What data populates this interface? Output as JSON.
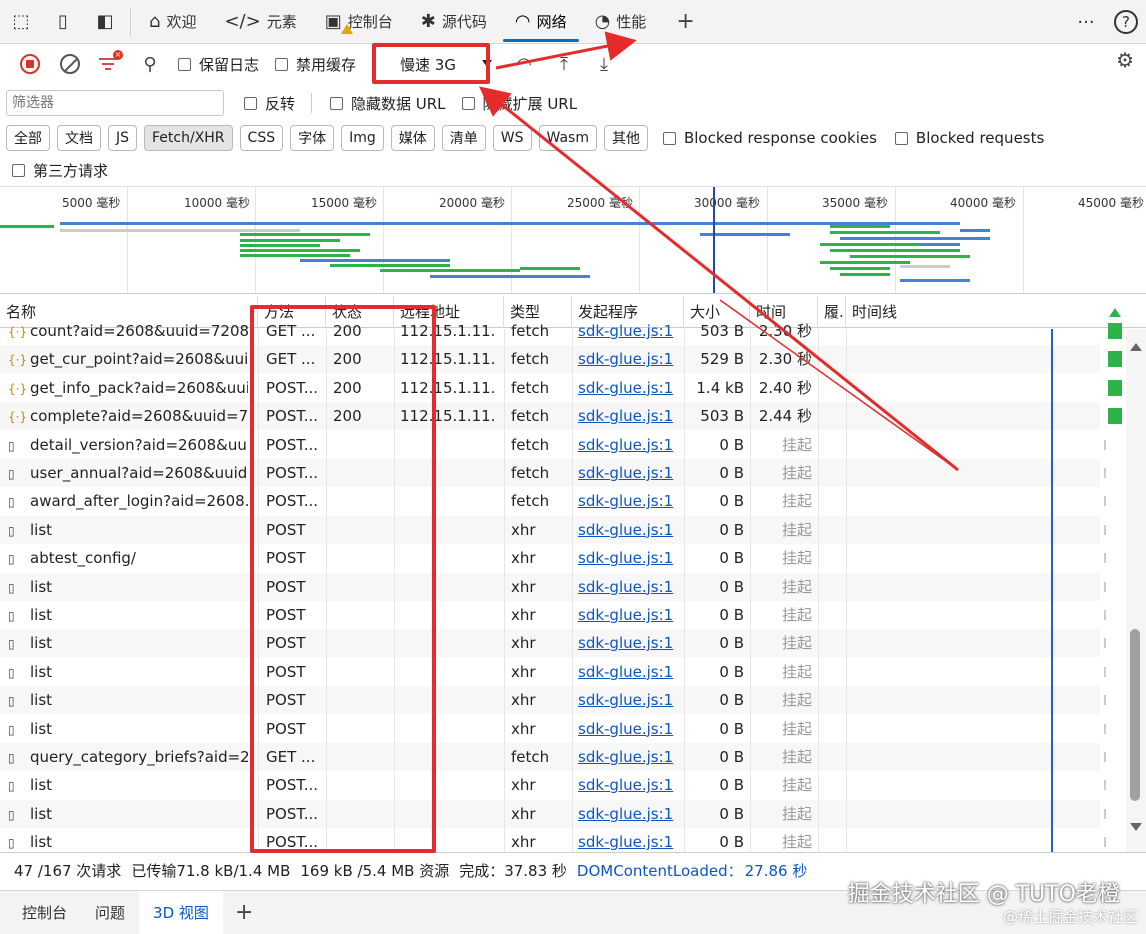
{
  "tabbar": {
    "tabs": [
      {
        "label": "欢迎",
        "icon": "home-icon"
      },
      {
        "label": "元素",
        "icon": "code-icon"
      },
      {
        "label": "控制台",
        "icon": "console-icon"
      },
      {
        "label": "源代码",
        "icon": "bug-icon"
      },
      {
        "label": "网络",
        "icon": "wifi-icon",
        "active": true
      },
      {
        "label": "性能",
        "icon": "gauge-icon"
      }
    ],
    "add_symbol": "+",
    "more_symbol": "···",
    "help_symbol": "?"
  },
  "toolbar": {
    "preserve_log": "保留日志",
    "disable_cache": "禁用缓存",
    "throttle": "慢速 3G"
  },
  "filter": {
    "placeholder": "筛选器",
    "invert": "反转",
    "hide_data_url": "隐藏数据 URL",
    "hide_ext_url": "隐藏扩展 URL"
  },
  "types": [
    "全部",
    "文档",
    "JS",
    "Fetch/XHR",
    "CSS",
    "字体",
    "Img",
    "媒体",
    "清单",
    "WS",
    "Wasm",
    "其他"
  ],
  "active_type": "Fetch/XHR",
  "type_checks": {
    "blocked_cookies": "Blocked response cookies",
    "blocked_requests": "Blocked requests"
  },
  "third_party": "第三方请求",
  "overview": {
    "labels": [
      "5000 毫秒",
      "10000 毫秒",
      "15000 毫秒",
      "20000 毫秒",
      "25000 毫秒",
      "30000 毫秒",
      "35000 毫秒",
      "40000 毫秒",
      "45000 毫秒"
    ]
  },
  "columns": {
    "name": "名称",
    "method": "方法",
    "status": "状态",
    "remote": "远程地址",
    "type": "类型",
    "initiator": "发起程序",
    "size": "大小",
    "time": "时间",
    "fulfilled": "履.",
    "waterfall": "时间线"
  },
  "rows": [
    {
      "name": "count?aid=2608&uuid=7208...",
      "method": "GET ...",
      "status": "200",
      "remote": "112.15.1.11...",
      "type": "fetch",
      "initiator": "sdk-glue.js:1",
      "size": "503 B",
      "time": "2.30 秒",
      "icon": "fetch"
    },
    {
      "name": "get_cur_point?aid=2608&uui...",
      "method": "GET ...",
      "status": "200",
      "remote": "112.15.1.11...",
      "type": "fetch",
      "initiator": "sdk-glue.js:1",
      "size": "529 B",
      "time": "2.30 秒",
      "icon": "fetch"
    },
    {
      "name": "get_info_pack?aid=2608&uui...",
      "method": "POST...",
      "status": "200",
      "remote": "112.15.1.11...",
      "type": "fetch",
      "initiator": "sdk-glue.js:1",
      "size": "1.4 kB",
      "time": "2.40 秒",
      "icon": "fetch"
    },
    {
      "name": "complete?aid=2608&uuid=7...",
      "method": "POST...",
      "status": "200",
      "remote": "112.15.1.11...",
      "type": "fetch",
      "initiator": "sdk-glue.js:1",
      "size": "503 B",
      "time": "2.44 秒",
      "icon": "fetch"
    },
    {
      "name": "detail_version?aid=2608&uui...",
      "method": "POST...",
      "status": "",
      "remote": "",
      "type": "fetch",
      "initiator": "sdk-glue.js:1",
      "size": "0 B",
      "time": "挂起",
      "icon": "doc"
    },
    {
      "name": "user_annual?aid=2608&uuid...",
      "method": "POST...",
      "status": "",
      "remote": "",
      "type": "fetch",
      "initiator": "sdk-glue.js:1",
      "size": "0 B",
      "time": "挂起",
      "icon": "doc"
    },
    {
      "name": "award_after_login?aid=2608...",
      "method": "POST...",
      "status": "",
      "remote": "",
      "type": "fetch",
      "initiator": "sdk-glue.js:1",
      "size": "0 B",
      "time": "挂起",
      "icon": "doc"
    },
    {
      "name": "list",
      "method": "POST",
      "status": "",
      "remote": "",
      "type": "xhr",
      "initiator": "sdk-glue.js:1",
      "size": "0 B",
      "time": "挂起",
      "icon": "doc"
    },
    {
      "name": "abtest_config/",
      "method": "POST",
      "status": "",
      "remote": "",
      "type": "xhr",
      "initiator": "sdk-glue.js:1",
      "size": "0 B",
      "time": "挂起",
      "icon": "doc"
    },
    {
      "name": "list",
      "method": "POST",
      "status": "",
      "remote": "",
      "type": "xhr",
      "initiator": "sdk-glue.js:1",
      "size": "0 B",
      "time": "挂起",
      "icon": "doc"
    },
    {
      "name": "list",
      "method": "POST",
      "status": "",
      "remote": "",
      "type": "xhr",
      "initiator": "sdk-glue.js:1",
      "size": "0 B",
      "time": "挂起",
      "icon": "doc"
    },
    {
      "name": "list",
      "method": "POST",
      "status": "",
      "remote": "",
      "type": "xhr",
      "initiator": "sdk-glue.js:1",
      "size": "0 B",
      "time": "挂起",
      "icon": "doc"
    },
    {
      "name": "list",
      "method": "POST",
      "status": "",
      "remote": "",
      "type": "xhr",
      "initiator": "sdk-glue.js:1",
      "size": "0 B",
      "time": "挂起",
      "icon": "doc"
    },
    {
      "name": "list",
      "method": "POST",
      "status": "",
      "remote": "",
      "type": "xhr",
      "initiator": "sdk-glue.js:1",
      "size": "0 B",
      "time": "挂起",
      "icon": "doc"
    },
    {
      "name": "list",
      "method": "POST",
      "status": "",
      "remote": "",
      "type": "xhr",
      "initiator": "sdk-glue.js:1",
      "size": "0 B",
      "time": "挂起",
      "icon": "doc"
    },
    {
      "name": "query_category_briefs?aid=2...",
      "method": "GET ...",
      "status": "",
      "remote": "",
      "type": "fetch",
      "initiator": "sdk-glue.js:1",
      "size": "0 B",
      "time": "挂起",
      "icon": "doc"
    },
    {
      "name": "list",
      "method": "POST...",
      "status": "",
      "remote": "",
      "type": "xhr",
      "initiator": "sdk-glue.js:1",
      "size": "0 B",
      "time": "挂起",
      "icon": "doc"
    },
    {
      "name": "list",
      "method": "POST...",
      "status": "",
      "remote": "",
      "type": "xhr",
      "initiator": "sdk-glue.js:1",
      "size": "0 B",
      "time": "挂起",
      "icon": "doc"
    },
    {
      "name": "list",
      "method": "POST...",
      "status": "",
      "remote": "",
      "type": "xhr",
      "initiator": "sdk-glue.js:1",
      "size": "0 B",
      "time": "挂起",
      "icon": "doc"
    }
  ],
  "status": {
    "requests": "47 /167 次请求",
    "transferred": "已传输71.8 kB/1.4 MB",
    "resources": "169 kB /5.4 MB 资源",
    "finish": "完成：37.83 秒",
    "dcl_label": "DOMContentLoaded：",
    "dcl_value": "27.86 秒"
  },
  "drawer": {
    "tabs": [
      "控制台",
      "问题",
      "3D 视图"
    ],
    "active": "3D 视图",
    "add_symbol": "+"
  },
  "watermark": {
    "line1": "掘金技术社区 @ TUTO老橙",
    "line2": "@稀土掘金技术社区"
  },
  "colors": {
    "accent": "#0f6cbd",
    "link": "#0b55c8",
    "annotation_red": "#e52b2b",
    "bar_green": "#2eb34a",
    "bar_blue": "#4a7fd6"
  }
}
